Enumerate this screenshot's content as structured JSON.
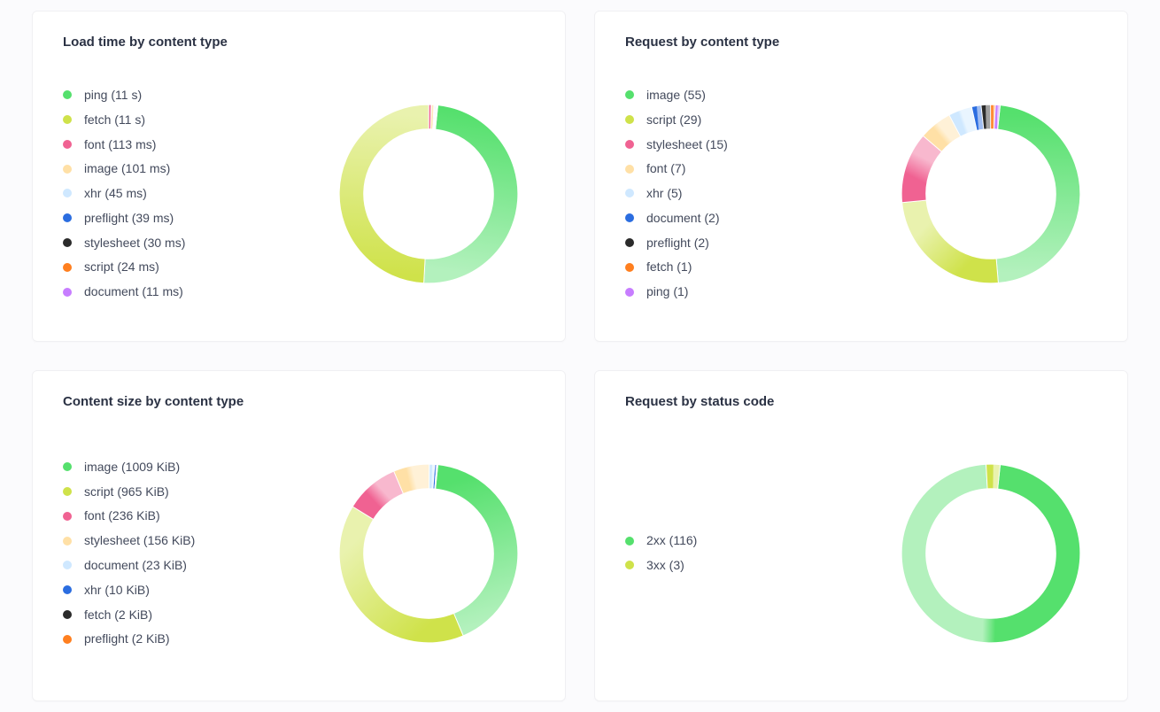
{
  "palette": {
    "ping": "#55e06d",
    "fetch": "#cfe24a",
    "font": "#f06292",
    "image": "#ffe0a6",
    "xhr": "#cfe8ff",
    "preflight": "#2b6de0",
    "stylesheet": "#2b2b2b",
    "script": "#ff7f1f",
    "document": "#c77dff",
    "image_g": "#55e06d",
    "script_y": "#cfe24a",
    "stylesheet_p": "#f06292",
    "font_cr": "#ffe0a6",
    "xhr_lb": "#cfe8ff",
    "document_b": "#2b6de0",
    "preflight_bk": "#2b2b2b",
    "fetch_o": "#ff7f1f",
    "ping_pu": "#c77dff",
    "2xx": "#55e06d",
    "3xx": "#cfe24a"
  },
  "cards": [
    {
      "id": "load-time",
      "title": "Load time by content type",
      "items": [
        {
          "name": "ping",
          "value_str": "11 s",
          "value": 11000,
          "color": "ping"
        },
        {
          "name": "fetch",
          "value_str": "11 s",
          "value": 11000,
          "color": "fetch"
        },
        {
          "name": "font",
          "value_str": "113 ms",
          "value": 113,
          "color": "font"
        },
        {
          "name": "image",
          "value_str": "101 ms",
          "value": 101,
          "color": "image"
        },
        {
          "name": "xhr",
          "value_str": "45 ms",
          "value": 45,
          "color": "xhr"
        },
        {
          "name": "preflight",
          "value_str": "39 ms",
          "value": 39,
          "color": "preflight"
        },
        {
          "name": "stylesheet",
          "value_str": "30 ms",
          "value": 30,
          "color": "stylesheet"
        },
        {
          "name": "script",
          "value_str": "24 ms",
          "value": 24,
          "color": "script"
        },
        {
          "name": "document",
          "value_str": "11 ms",
          "value": 11,
          "color": "document"
        }
      ]
    },
    {
      "id": "request-by-type",
      "title": "Request by content type",
      "items": [
        {
          "name": "image",
          "value_str": "55",
          "value": 55,
          "color": "image_g"
        },
        {
          "name": "script",
          "value_str": "29",
          "value": 29,
          "color": "script_y"
        },
        {
          "name": "stylesheet",
          "value_str": "15",
          "value": 15,
          "color": "stylesheet_p"
        },
        {
          "name": "font",
          "value_str": "7",
          "value": 7,
          "color": "font_cr"
        },
        {
          "name": "xhr",
          "value_str": "5",
          "value": 5,
          "color": "xhr_lb"
        },
        {
          "name": "document",
          "value_str": "2",
          "value": 2,
          "color": "document_b"
        },
        {
          "name": "preflight",
          "value_str": "2",
          "value": 2,
          "color": "preflight_bk"
        },
        {
          "name": "fetch",
          "value_str": "1",
          "value": 1,
          "color": "fetch_o"
        },
        {
          "name": "ping",
          "value_str": "1",
          "value": 1,
          "color": "ping_pu"
        }
      ]
    },
    {
      "id": "content-size",
      "title": "Content size by content type",
      "items": [
        {
          "name": "image",
          "value_str": "1009 KiB",
          "value": 1009,
          "color": "image_g"
        },
        {
          "name": "script",
          "value_str": "965 KiB",
          "value": 965,
          "color": "script_y"
        },
        {
          "name": "font",
          "value_str": "236 KiB",
          "value": 236,
          "color": "stylesheet_p"
        },
        {
          "name": "stylesheet",
          "value_str": "156 KiB",
          "value": 156,
          "color": "font_cr"
        },
        {
          "name": "document",
          "value_str": "23 KiB",
          "value": 23,
          "color": "xhr_lb"
        },
        {
          "name": "xhr",
          "value_str": "10 KiB",
          "value": 10,
          "color": "document_b"
        },
        {
          "name": "fetch",
          "value_str": "2 KiB",
          "value": 2,
          "color": "preflight_bk"
        },
        {
          "name": "preflight",
          "value_str": "2 KiB",
          "value": 2,
          "color": "fetch_o"
        }
      ]
    },
    {
      "id": "request-by-status",
      "title": "Request by status code",
      "status": true,
      "items": [
        {
          "name": "2xx",
          "value_str": "116",
          "value": 116,
          "color": "2xx"
        },
        {
          "name": "3xx",
          "value_str": "3",
          "value": 3,
          "color": "3xx"
        }
      ]
    }
  ],
  "chart_data": [
    {
      "type": "pie",
      "title": "Load time by content type",
      "categories": [
        "ping",
        "fetch",
        "font",
        "image",
        "xhr",
        "preflight",
        "stylesheet",
        "script",
        "document"
      ],
      "values_ms": [
        11000,
        11000,
        113,
        101,
        45,
        39,
        30,
        24,
        11
      ],
      "unit": "ms"
    },
    {
      "type": "pie",
      "title": "Request by content type",
      "categories": [
        "image",
        "script",
        "stylesheet",
        "font",
        "xhr",
        "document",
        "preflight",
        "fetch",
        "ping"
      ],
      "values": [
        55,
        29,
        15,
        7,
        5,
        2,
        2,
        1,
        1
      ],
      "unit": "requests"
    },
    {
      "type": "pie",
      "title": "Content size by content type",
      "categories": [
        "image",
        "script",
        "font",
        "stylesheet",
        "document",
        "xhr",
        "fetch",
        "preflight"
      ],
      "values_kib": [
        1009,
        965,
        236,
        156,
        23,
        10,
        2,
        2
      ],
      "unit": "KiB"
    },
    {
      "type": "pie",
      "title": "Request by status code",
      "categories": [
        "2xx",
        "3xx"
      ],
      "values": [
        116,
        3
      ],
      "unit": "requests"
    }
  ]
}
